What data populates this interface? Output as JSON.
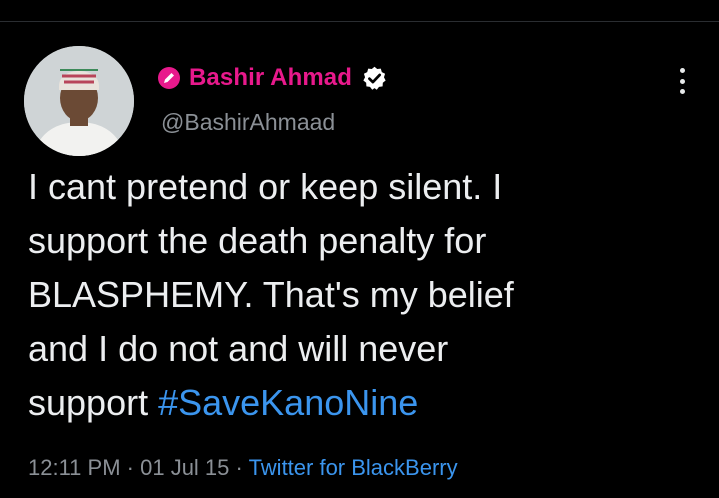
{
  "tweet": {
    "author": {
      "display_name": "Bashir Ahmad",
      "handle": "@BashirAhmaad",
      "verified": true,
      "name_color": "#e8198c",
      "badge_icon": "pen-icon",
      "verified_icon": "verified-badge-icon"
    },
    "text_lines": [
      "I cant pretend or keep silent. I",
      "support the death penalty for",
      "BLASPHEMY. That's my belief",
      "and I do not and will never",
      "support "
    ],
    "hashtag": "#SaveKanoNine",
    "time": "12:11 PM",
    "separator": " · ",
    "date": "01 Jul 15",
    "source": "Twitter for BlackBerry",
    "link_color": "#3b95ee",
    "more_icon": "more-vertical-icon"
  }
}
